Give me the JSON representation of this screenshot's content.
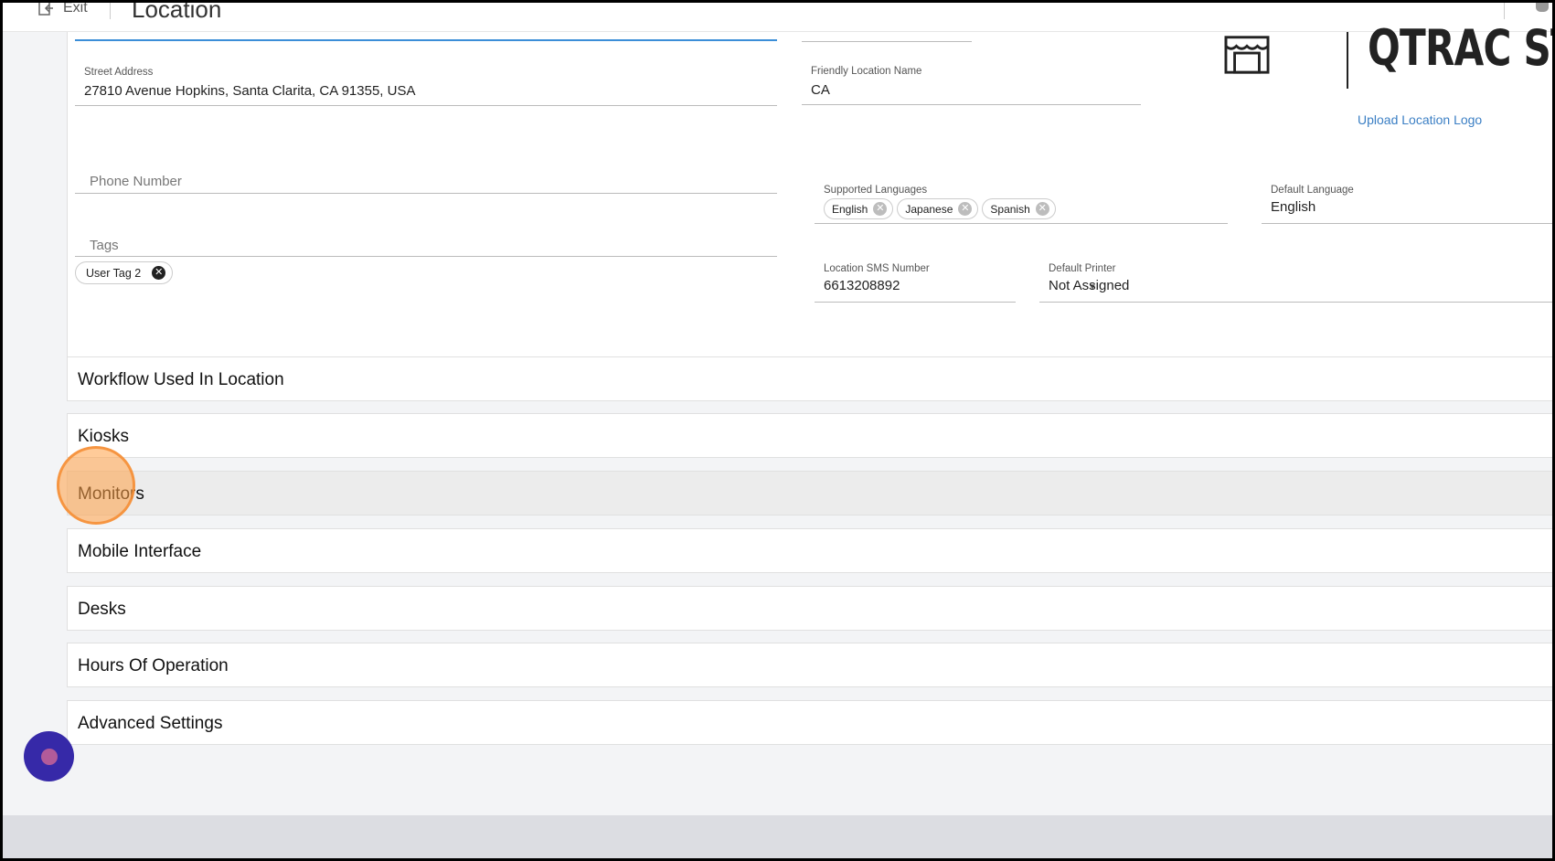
{
  "topbar": {
    "exit_label": "Exit",
    "page_title": "Location"
  },
  "form": {
    "street_address_label": "Street Address",
    "street_address_value": "27810 Avenue Hopkins, Santa Clarita, CA 91355, USA",
    "friendly_name_label": "Friendly Location Name",
    "friendly_name_value": "CA",
    "phone_placeholder": "Phone Number",
    "tags_placeholder": "Tags",
    "tags": [
      "User Tag 2"
    ],
    "supported_languages_label": "Supported Languages",
    "supported_languages": [
      "English",
      "Japanese",
      "Spanish"
    ],
    "default_language_label": "Default Language",
    "default_language_value": "English",
    "sms_number_label": "Location SMS Number",
    "sms_number_value": "6613208892",
    "default_printer_label": "Default Printer",
    "default_printer_value": "Not Assigned"
  },
  "logo": {
    "text": "QTRAC STORE",
    "upload_label": "Upload Location Logo"
  },
  "sections": [
    {
      "title": "Workflow Used In Location"
    },
    {
      "title": "Kiosks"
    },
    {
      "title": "Monitors"
    },
    {
      "title": "Mobile Interface"
    },
    {
      "title": "Desks"
    },
    {
      "title": "Hours Of Operation"
    },
    {
      "title": "Advanced Settings"
    }
  ],
  "colors": {
    "accent_blue": "#3b7fc4",
    "chat_button": "#3629a8",
    "click_highlight": "#f5a050"
  }
}
